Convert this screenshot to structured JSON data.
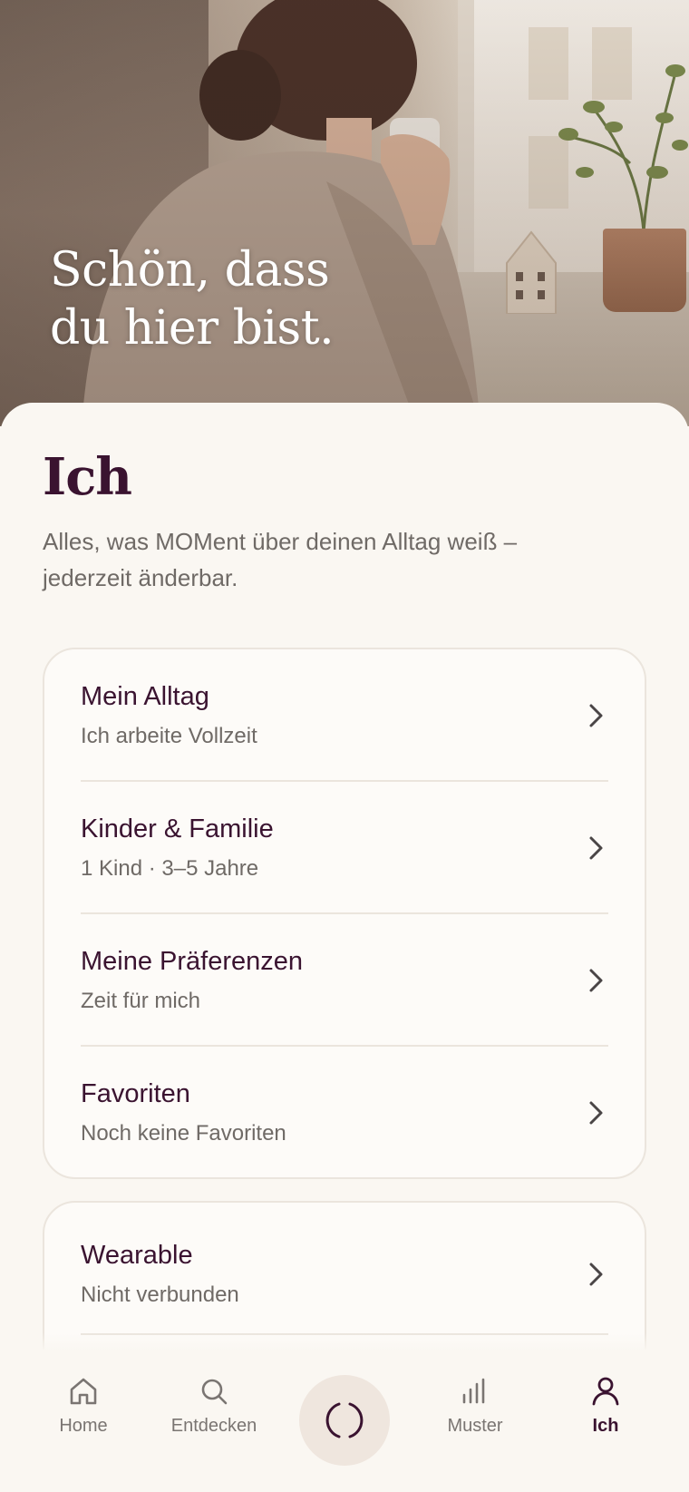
{
  "hero": {
    "title_line1": "Schön, dass",
    "title_line2": "du hier bist."
  },
  "page": {
    "title": "Ich",
    "subtitle": "Alles, was MOMent über deinen Alltag weiß – jederzeit änderbar."
  },
  "profile_card": {
    "items": [
      {
        "title": "Mein Alltag",
        "subtitle": "Ich arbeite Vollzeit",
        "icon": "chevron-right-icon"
      },
      {
        "title": "Kinder & Familie",
        "subtitle": "1 Kind · 3–5 Jahre",
        "icon": "chevron-right-icon"
      },
      {
        "title": "Meine Präferenzen",
        "subtitle": "Zeit für mich",
        "icon": "chevron-right-icon"
      },
      {
        "title": "Favoriten",
        "subtitle": "Noch keine Favoriten",
        "icon": "chevron-right-icon"
      }
    ]
  },
  "device_card": {
    "items": [
      {
        "title": "Wearable",
        "subtitle": "Nicht verbunden",
        "icon": "chevron-right-icon"
      }
    ]
  },
  "nav": {
    "items": [
      {
        "label": "Home",
        "icon": "home-icon",
        "active": false
      },
      {
        "label": "Entdecken",
        "icon": "search-icon",
        "active": false
      },
      {
        "label": "",
        "icon": "moment-circle-icon",
        "active": false
      },
      {
        "label": "Muster",
        "icon": "bar-chart-icon",
        "active": false
      },
      {
        "label": "Ich",
        "icon": "person-icon",
        "active": true
      }
    ]
  },
  "colors": {
    "brand_plum": "#3a1330",
    "background": "#faf7f2",
    "muted_text": "#6f6a66",
    "card_border": "#ebe5dd",
    "center_button_bg": "#efe6de"
  }
}
